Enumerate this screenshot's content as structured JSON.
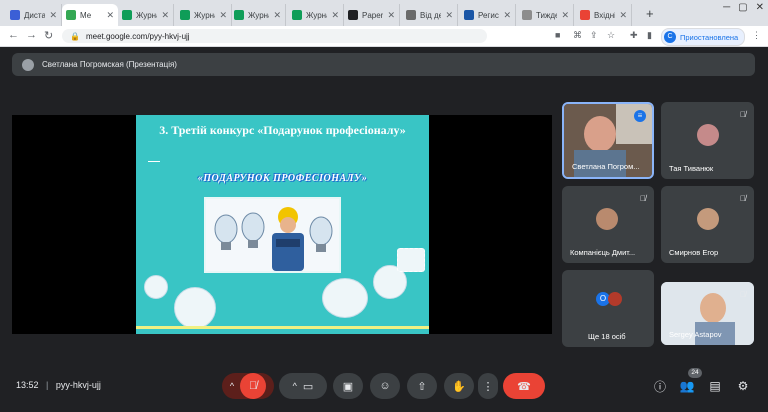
{
  "tabs": [
    {
      "title": "Дистан",
      "color": "#3b5fd6"
    },
    {
      "title": "Ме",
      "color": "#34a853",
      "active": true
    },
    {
      "title": "Журна",
      "color": "#0f9d58"
    },
    {
      "title": "Журна",
      "color": "#0f9d58"
    },
    {
      "title": "Журна",
      "color": "#0f9d58"
    },
    {
      "title": "Журна",
      "color": "#0f9d58"
    },
    {
      "title": "Paperl",
      "color": "#202124"
    },
    {
      "title": "Від де",
      "color": "#6a6a6a"
    },
    {
      "title": "Регист",
      "color": "#1a56a6"
    },
    {
      "title": "Тижде",
      "color": "#8d8d8d"
    },
    {
      "title": "Вхідні",
      "color": "#ea4335"
    }
  ],
  "address": {
    "url": "meet.google.com/pyy-hkvj-ujj",
    "profile_label": "Приостановлена",
    "profile_initial": "С"
  },
  "presentation_bar": {
    "label": "Светлана Погромская (Презентація)"
  },
  "slide": {
    "heading": "3. Третій  конкурс «Подарунок професіоналу»",
    "wordart": "«ПОДАРУНОК ПРОФЕСІОНАЛУ»"
  },
  "participants": [
    {
      "name": "Светлана Погром...",
      "speaking": true
    },
    {
      "name": "Тая Тиванюк",
      "muted": true
    },
    {
      "name": "Компанієць Дмит...",
      "muted": true
    },
    {
      "name": "Смирнов Егор",
      "muted": true
    },
    {
      "name": "Ще 18 осіб",
      "initial": "О"
    },
    {
      "name": "Sergey Astapov",
      "muted": true
    }
  ],
  "meeting": {
    "time": "13:52",
    "code": "pyy-hkvj-ujj",
    "people_count": "24"
  },
  "icons": {
    "mic_off": "mic-off-icon",
    "camera": "camera-icon",
    "captions": "captions-icon",
    "emoji": "emoji-icon",
    "present": "present-icon",
    "hand": "raise-hand-icon",
    "more": "more-icon",
    "end": "end-call-icon",
    "info": "info-icon",
    "people": "people-icon",
    "chat": "chat-icon",
    "activities": "activities-icon"
  },
  "colors": {
    "end_call": "#ea4335",
    "mic_off_bg": "#ea4335",
    "speaking_border": "#8ab4f8",
    "slide_bg": "#39c5c5"
  }
}
